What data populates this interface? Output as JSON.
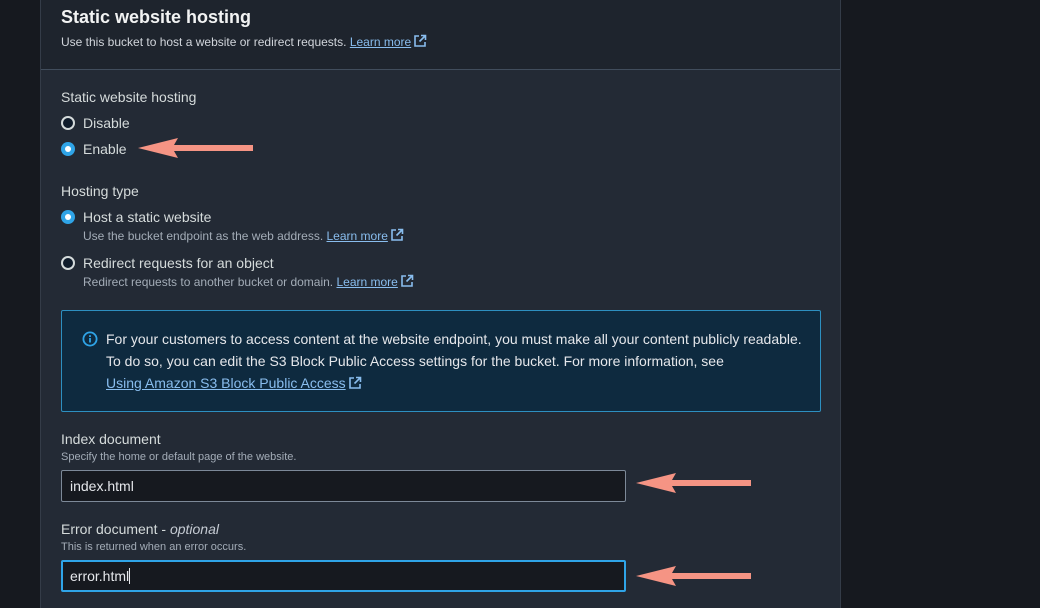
{
  "section": {
    "title": "Static website hosting",
    "description": "Use this bucket to host a website or redirect requests.",
    "learn_more": "Learn more"
  },
  "hosting": {
    "label": "Static website hosting",
    "options": [
      {
        "label": "Disable",
        "checked": false
      },
      {
        "label": "Enable",
        "checked": true
      }
    ]
  },
  "hosting_type": {
    "label": "Hosting type",
    "options": [
      {
        "label": "Host a static website",
        "description": "Use the bucket endpoint as the web address.",
        "learn_more": "Learn more",
        "checked": true
      },
      {
        "label": "Redirect requests for an object",
        "description": "Redirect requests to another bucket or domain.",
        "learn_more": "Learn more",
        "checked": false
      }
    ]
  },
  "info": {
    "text": "For your customers to access content at the website endpoint, you must make all your content publicly readable. To do so, you can edit the S3 Block Public Access settings for the bucket. For more information, see",
    "link": "Using Amazon S3 Block Public Access"
  },
  "index_document": {
    "label": "Index document",
    "description": "Specify the home or default page of the website.",
    "value": "index.html"
  },
  "error_document": {
    "label": "Error document",
    "optional": "optional",
    "description": "This is returned when an error occurs.",
    "value": "error.html"
  },
  "colors": {
    "accent": "#2fa4e7",
    "link": "#89bdee",
    "annotation_arrow": "#f59484"
  },
  "icons": [
    "external-link-icon",
    "info-icon",
    "annotation-arrow"
  ]
}
